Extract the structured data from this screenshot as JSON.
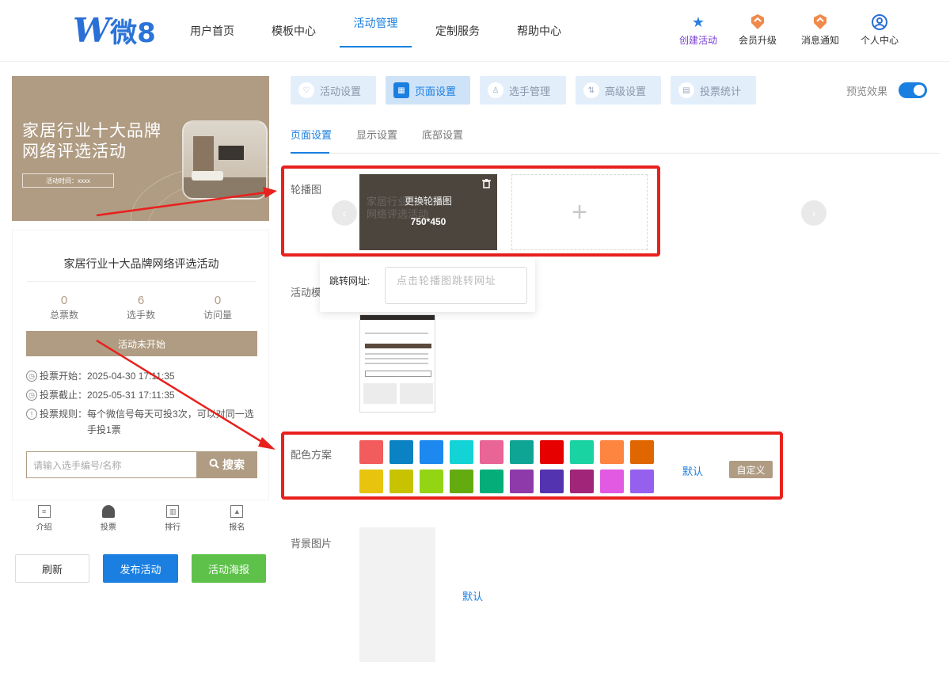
{
  "header": {
    "logo_letter": "W",
    "logo_text": "微8",
    "nav": [
      "用户首页",
      "模板中心",
      "活动管理",
      "定制服务",
      "帮助中心"
    ],
    "icons": [
      {
        "label": "创建活动",
        "icon": "star-icon"
      },
      {
        "label": "会员升级",
        "icon": "crown-badge-icon"
      },
      {
        "label": "消息通知",
        "icon": "bell-badge-icon"
      },
      {
        "label": "个人中心",
        "icon": "user-circle-icon"
      }
    ]
  },
  "preview": {
    "banner_title": "家居行业十大品牌网络评选活动",
    "banner_time": "活动时间：xxxx",
    "card_title": "家居行业十大品牌网络评选活动",
    "stats": [
      {
        "value": "0",
        "label": "总票数"
      },
      {
        "value": "6",
        "label": "选手数"
      },
      {
        "value": "0",
        "label": "访问量"
      }
    ],
    "status": "活动未开始",
    "info": [
      {
        "key": "投票开始：",
        "value": "2025-04-30 17:11:35"
      },
      {
        "key": "投票截止：",
        "value": "2025-05-31 17:11:35"
      },
      {
        "key": "投票规则：",
        "value": "每个微信号每天可投3次，可以对同一选手投1票"
      }
    ],
    "search_placeholder": "请输入选手编号/名称",
    "search_btn": "搜索",
    "tabbar": [
      "介绍",
      "投票",
      "排行",
      "报名"
    ],
    "buttons": {
      "refresh": "刷新",
      "publish": "发布活动",
      "poster": "活动海报"
    }
  },
  "settings": {
    "tabs": [
      "活动设置",
      "页面设置",
      "选手管理",
      "高级设置",
      "投票统计"
    ],
    "active_tab": "页面设置",
    "preview_label": "预览效果",
    "preview_on": true,
    "subtabs": [
      "页面设置",
      "显示设置",
      "底部设置"
    ],
    "carousel_label": "轮播图",
    "carousel_change": "更换轮播图",
    "carousel_size": "750*450",
    "carousel_add": "+",
    "jump_label": "跳转网址:",
    "jump_placeholder": "点击轮播图跳转网址",
    "template_label": "活动模",
    "color_label": "配色方案",
    "colors": [
      "#f25c5c",
      "#0a82c4",
      "#1c88f0",
      "#13d3d6",
      "#e96595",
      "#0fa595",
      "#e60000",
      "#1ad3a3",
      "#fe8540",
      "#e06600",
      "#e8c40f",
      "#c7c300",
      "#93d514",
      "#64ab10",
      "#03ae78",
      "#8e3aaa",
      "#5433b1",
      "#a1267a",
      "#e15ae1",
      "#9560ee"
    ],
    "color_default": "默认",
    "color_custom": "自定义",
    "bg_label": "背景图片",
    "bg_default": "默认"
  }
}
